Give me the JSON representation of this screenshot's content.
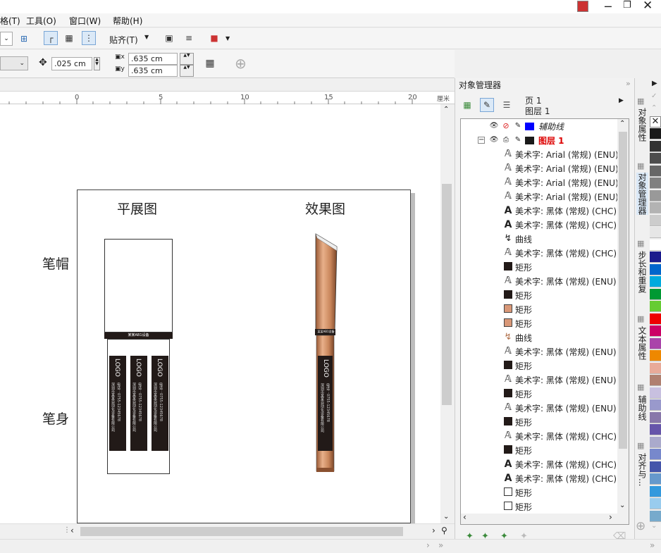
{
  "menubar": {
    "items": [
      "格(T)",
      "工具(O)",
      "窗口(W)",
      "帮助(H)"
    ]
  },
  "toolbar1": {
    "snap_label": "贴齐(T)"
  },
  "toolbar2": {
    "nudge_value": ".025 cm",
    "dup_x": ".635 cm",
    "dup_y": ".635 cm"
  },
  "ruler": {
    "ticks": [
      "0",
      "5",
      "10",
      "15",
      "20"
    ],
    "unit": "厘米"
  },
  "canvas": {
    "title_flat": "平展图",
    "title_effect": "效果图",
    "label_cap": "笔帽",
    "label_body": "笔身",
    "logo_text": "LOGO",
    "band_text": "某某AB1设备",
    "company_lines": [
      "深圳市某某自动化设备有限公司",
      "电话：0755-12345678",
      "网址：www.xxxxxx.com"
    ]
  },
  "docker": {
    "title": "对象管理器",
    "page_label": "页 1",
    "layer_label": "图层 1",
    "layers": [
      {
        "name": "辅助线",
        "color": "#0000ff",
        "italic": true
      },
      {
        "name": "图层 1",
        "color": "#1a1a1a",
        "red": true
      }
    ],
    "items": [
      {
        "icon": "text-outline",
        "label": "美术字: Arial (常规) (ENU)"
      },
      {
        "icon": "text-outline",
        "label": "美术字: Arial (常规) (ENU)"
      },
      {
        "icon": "text-outline",
        "label": "美术字: Arial (常规) (ENU)"
      },
      {
        "icon": "text-outline",
        "label": "美术字: Arial (常规) (ENU)"
      },
      {
        "icon": "text-bold",
        "label": "美术字: 黑体 (常规) (CHC)"
      },
      {
        "icon": "text-bold",
        "label": "美术字: 黑体 (常规) (CHC)"
      },
      {
        "icon": "curve-dark",
        "label": "曲线"
      },
      {
        "icon": "text-outline",
        "label": "美术字: 黑体 (常规) (CHC)"
      },
      {
        "icon": "rect-black",
        "label": "矩形"
      },
      {
        "icon": "text-outline",
        "label": "美术字: 黑体 (常规) (ENU)"
      },
      {
        "icon": "rect-black",
        "label": "矩形"
      },
      {
        "icon": "rect-copper",
        "label": "矩形"
      },
      {
        "icon": "rect-copper",
        "label": "矩形"
      },
      {
        "icon": "curve-copper",
        "label": "曲线"
      },
      {
        "icon": "text-outline",
        "label": "美术字: 黑体 (常规) (ENU)"
      },
      {
        "icon": "rect-black",
        "label": "矩形"
      },
      {
        "icon": "text-outline",
        "label": "美术字: 黑体 (常规) (ENU)"
      },
      {
        "icon": "rect-black",
        "label": "矩形"
      },
      {
        "icon": "text-outline",
        "label": "美术字: 黑体 (常规) (ENU)"
      },
      {
        "icon": "rect-black",
        "label": "矩形"
      },
      {
        "icon": "text-outline",
        "label": "美术字: 黑体 (常规) (CHC)"
      },
      {
        "icon": "rect-black",
        "label": "矩形"
      },
      {
        "icon": "text-bold",
        "label": "美术字: 黑体 (常规) (CHC)"
      },
      {
        "icon": "text-bold",
        "label": "美术字: 黑体 (常规) (CHC)"
      },
      {
        "icon": "rect-empty",
        "label": "矩形"
      },
      {
        "icon": "rect-empty",
        "label": "矩形"
      }
    ]
  },
  "side_tabs": [
    "对象属性",
    "对象管理器",
    "步长和重复",
    "文本属性",
    "辅助线",
    "对齐与..."
  ],
  "palette": [
    "#1a1a1a",
    "#333333",
    "#4d4d4d",
    "#666666",
    "#808080",
    "#999999",
    "#b3b3b3",
    "#cccccc",
    "#e6e6e6",
    "#ffffff",
    "#1a1a8c",
    "#0066cc",
    "#00aadd",
    "#009933",
    "#66cc33",
    "#ee0000",
    "#cc0066",
    "#aa44aa",
    "#ee8800",
    "#e8aa99",
    "#b08070",
    "#c8c0e0",
    "#9999cc",
    "#8877aa",
    "#6655aa",
    "#aaaacc",
    "#7788cc",
    "#4455aa",
    "#6699cc",
    "#3399dd",
    "#99ccee",
    "#77aacc"
  ]
}
